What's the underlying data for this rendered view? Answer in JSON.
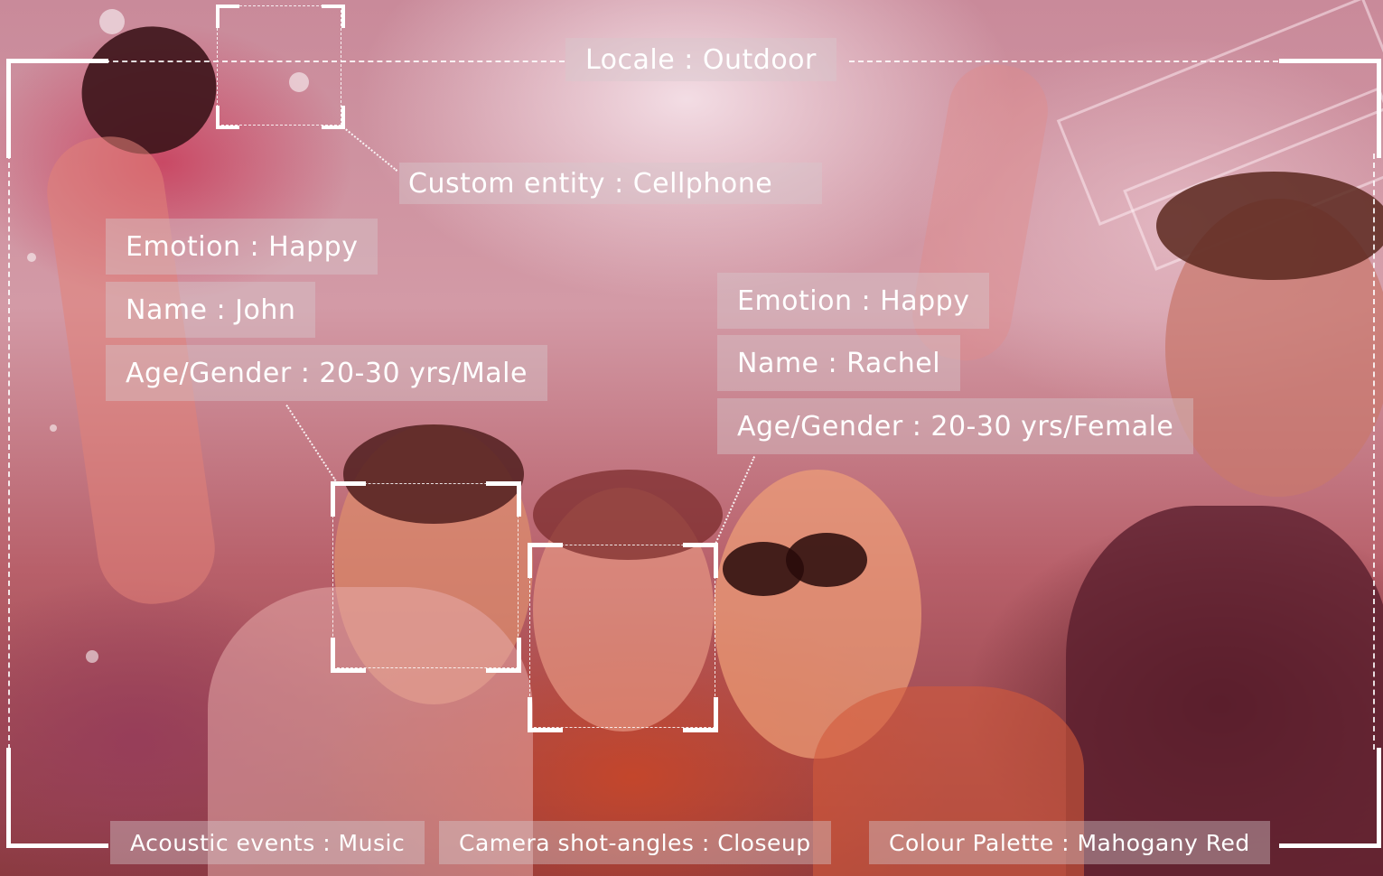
{
  "annotations": {
    "locale": "Locale : Outdoor",
    "custom_entity": "Custom entity : Cellphone",
    "person1": {
      "emotion": "Emotion : Happy",
      "name": "Name : John",
      "age_gender": "Age/Gender : 20-30 yrs/Male"
    },
    "person2": {
      "emotion": "Emotion : Happy",
      "name": "Name : Rachel",
      "age_gender": "Age/Gender : 20-30 yrs/Female"
    },
    "acoustic": "Acoustic events : Music",
    "camera": "Camera shot-angles : Closeup",
    "palette": "Colour Palette : Mahogany Red"
  }
}
